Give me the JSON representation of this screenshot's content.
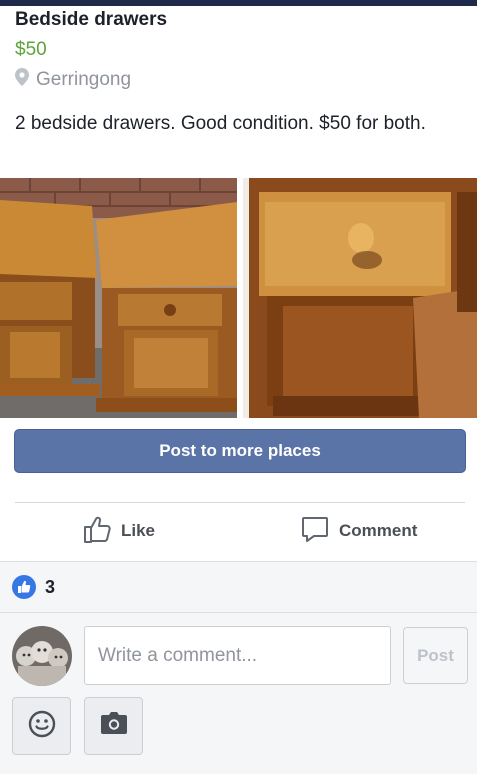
{
  "listing": {
    "title": "Bedside drawers",
    "price": "$50",
    "location": "Gerringong",
    "description": "2 bedside drawers. Good condition. $50 for both."
  },
  "actions": {
    "post_more": "Post to more places",
    "like": "Like",
    "comment": "Comment"
  },
  "reactions": {
    "like_count": "3"
  },
  "composer": {
    "placeholder": "Write a comment...",
    "post": "Post"
  },
  "icons": {
    "location": "map-pin-icon",
    "like": "thumbs-up-icon",
    "comment": "speech-bubble-icon",
    "reaction": "like-reaction-icon",
    "emoji": "smiley-icon",
    "camera": "camera-icon"
  },
  "colors": {
    "price": "#5fa33a",
    "primary_button": "#5b74a8",
    "like_badge": "#3578e5",
    "top_bar": "#1f2a4a"
  }
}
